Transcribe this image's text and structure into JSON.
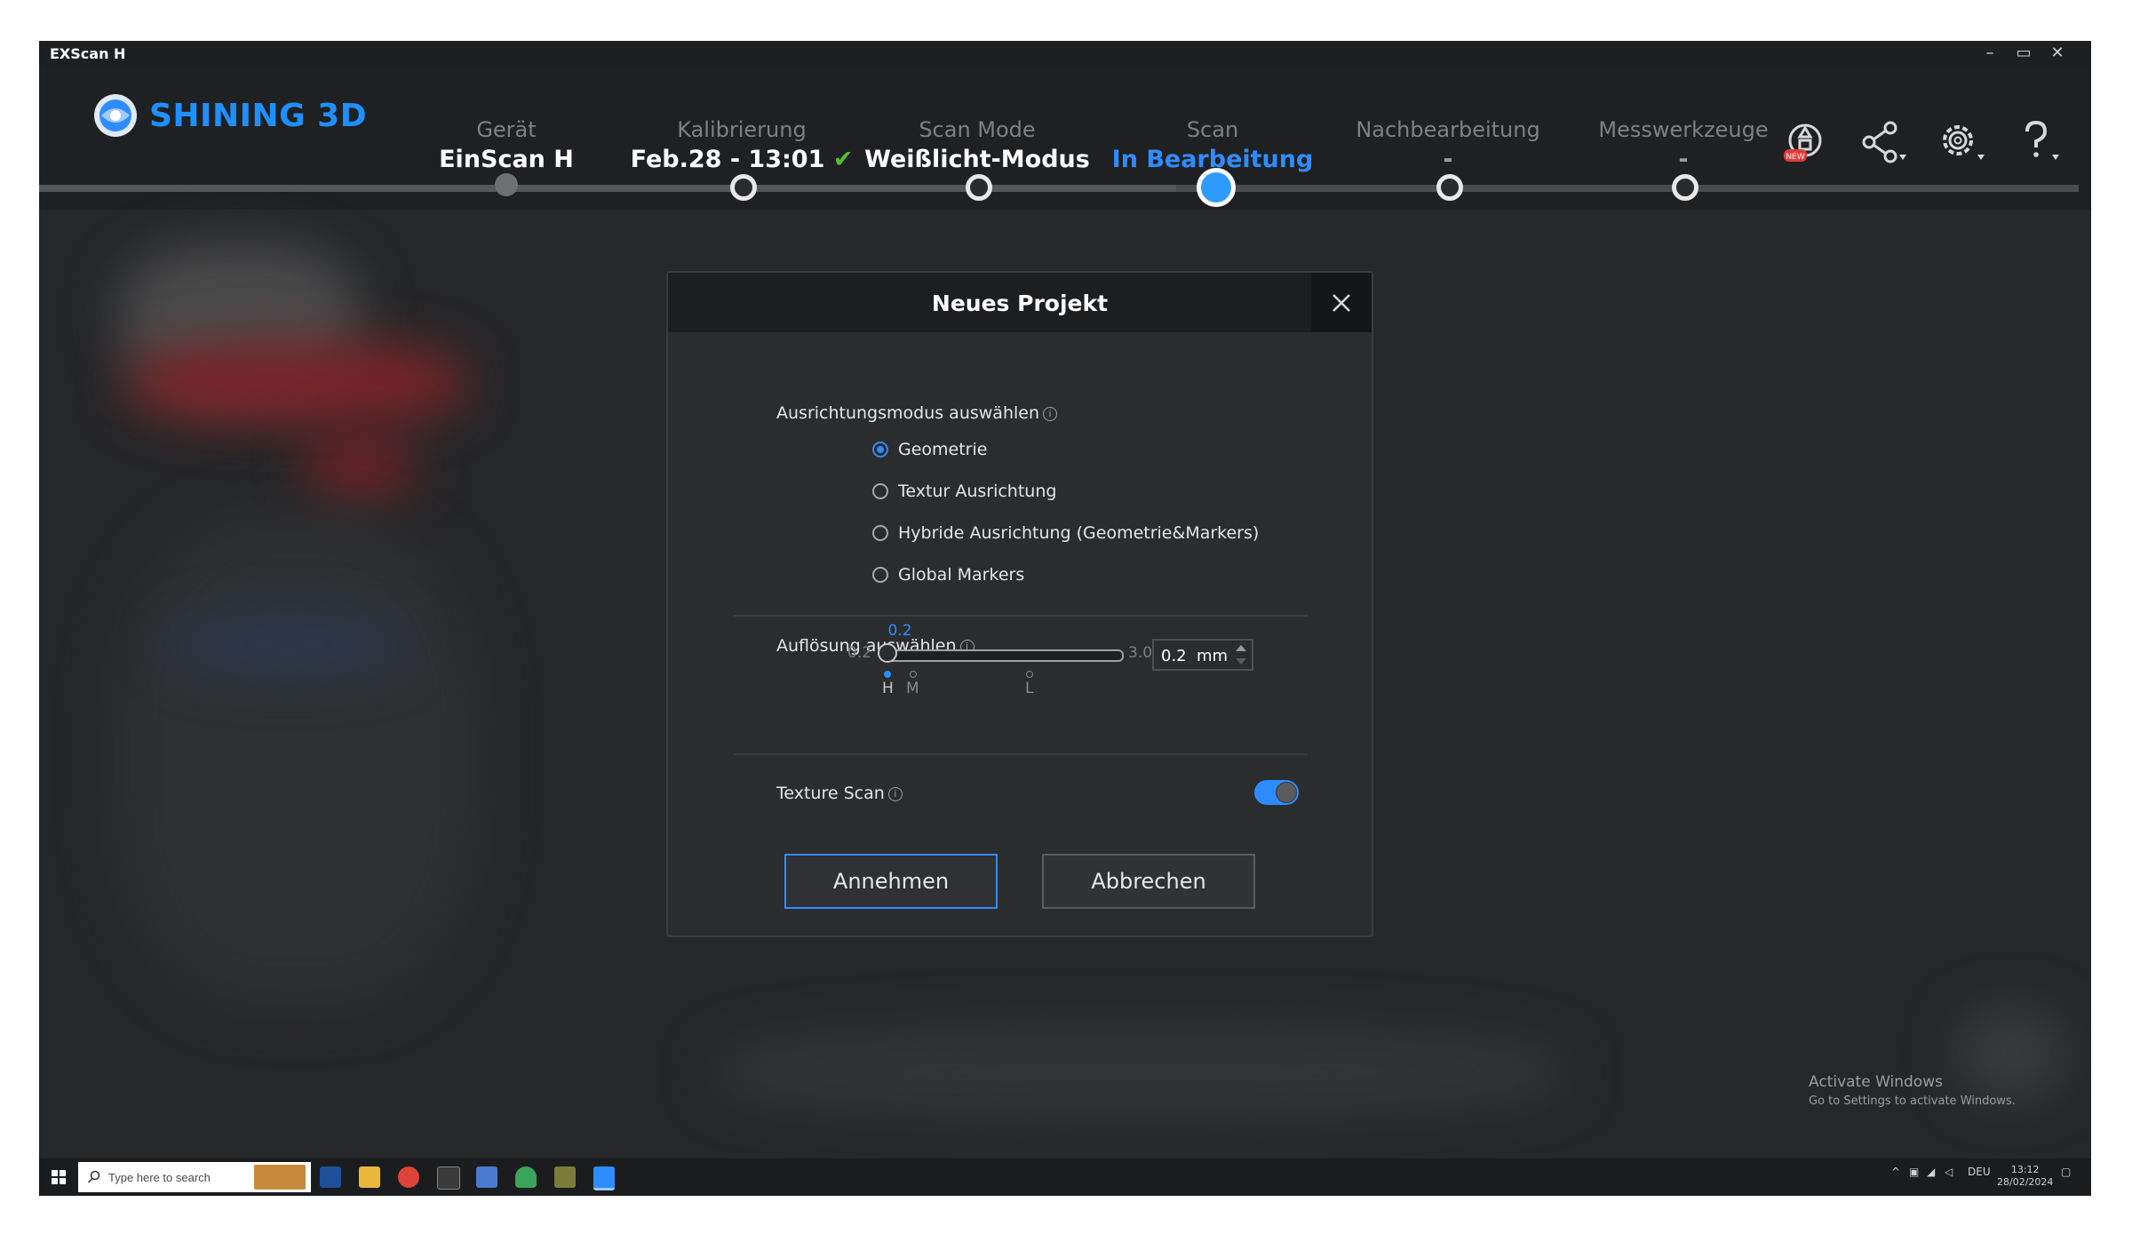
{
  "window": {
    "title": "EXScan H"
  },
  "brand": {
    "name": "SHINING 3D",
    "accent": "#2f8cff"
  },
  "steps": [
    {
      "label": "Gerät",
      "value": "EinScan H",
      "state": "done"
    },
    {
      "label": "Kalibrierung",
      "value": "Feb.28 - 13:01",
      "state": "ok",
      "check": "✔"
    },
    {
      "label": "Scan Mode",
      "value": "Weißlicht-Modus",
      "state": "ok"
    },
    {
      "label": "Scan",
      "value": "In Bearbeitung",
      "state": "active"
    },
    {
      "label": "Nachbearbeitung",
      "value": "-",
      "state": "pending"
    },
    {
      "label": "Messwerkzeuge",
      "value": "-",
      "state": "pending"
    }
  ],
  "header_icons": [
    "new-feature-icon",
    "share-icon",
    "settings-icon",
    "help-icon"
  ],
  "dialog": {
    "title": "Neues Projekt",
    "alignment": {
      "label": "Ausrichtungsmodus auswählen",
      "options": [
        {
          "label": "Geometrie",
          "checked": true
        },
        {
          "label": "Textur Ausrichtung",
          "checked": false
        },
        {
          "label": "Hybride Ausrichtung (Geometrie&Markers)",
          "checked": false
        },
        {
          "label": "Global Markers",
          "checked": false
        }
      ]
    },
    "resolution": {
      "label": "Auflösung auswählen",
      "current": "0.2",
      "min": "0.2",
      "max": "3.0",
      "value": "0.2",
      "unit": "mm",
      "ticks": [
        "H",
        "M",
        "L"
      ]
    },
    "texture": {
      "label": "Texture Scan",
      "enabled": true
    },
    "accept_label": "Annehmen",
    "cancel_label": "Abbrechen"
  },
  "watermark": {
    "line1": "Activate Windows",
    "line2": "Go to Settings to activate Windows."
  },
  "taskbar": {
    "search_placeholder": "Type here to search",
    "language": "DEU",
    "time": "13:12",
    "date": "28/02/2024"
  }
}
